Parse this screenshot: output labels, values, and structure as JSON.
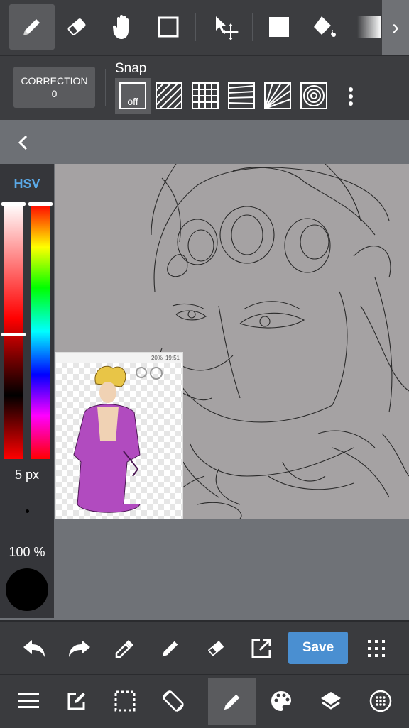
{
  "toolbar": {
    "tools": [
      "pen-icon",
      "eraser-icon",
      "hand-icon",
      "rectangle-icon",
      "move-select-icon",
      "fill-rect-icon",
      "bucket-icon",
      "gradient-icon"
    ],
    "more_arrow": "›"
  },
  "snap_bar": {
    "correction_label": "CORRECTION",
    "correction_value": "0",
    "snap_label": "Snap",
    "snap_off_label": "off"
  },
  "side_panel": {
    "color_mode": "HSV",
    "brush_size": "5 px",
    "opacity": "100 %"
  },
  "canvas": {
    "reference_status_battery": "20%",
    "reference_status_time": "19:51"
  },
  "bottom_actions": {
    "save_label": "Save"
  },
  "colors": {
    "accent": "#4a8fd1",
    "current_color": "#000000",
    "toolbar_bg": "#3c3d40",
    "canvas_bg": "#a5a2a3"
  }
}
